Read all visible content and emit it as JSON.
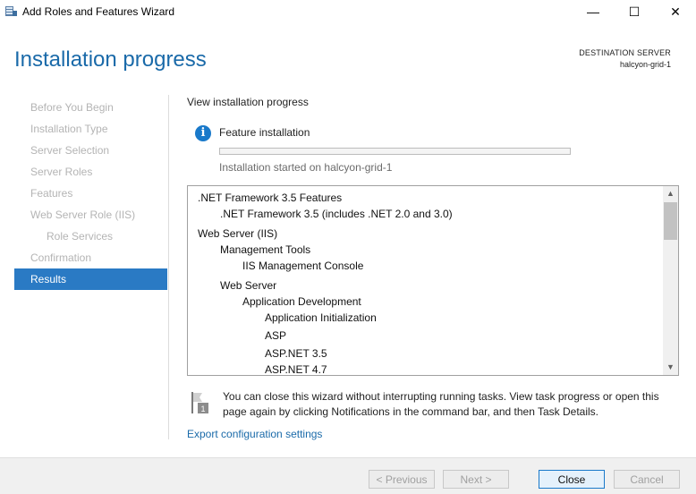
{
  "window": {
    "title": "Add Roles and Features Wizard",
    "minimize_glyph": "—",
    "maximize_glyph": "☐",
    "close_glyph": "✕"
  },
  "header": {
    "page_title": "Installation progress",
    "destination_label": "DESTINATION SERVER",
    "destination_server": "halcyon-grid-1"
  },
  "sidebar": {
    "items": [
      {
        "label": "Before You Begin",
        "state": "disabled"
      },
      {
        "label": "Installation Type",
        "state": "disabled"
      },
      {
        "label": "Server Selection",
        "state": "disabled"
      },
      {
        "label": "Server Roles",
        "state": "disabled"
      },
      {
        "label": "Features",
        "state": "disabled"
      },
      {
        "label": "Web Server Role (IIS)",
        "state": "disabled"
      },
      {
        "label": "Role Services",
        "state": "disabled"
      },
      {
        "label": "Confirmation",
        "state": "disabled"
      },
      {
        "label": "Results",
        "state": "active"
      }
    ]
  },
  "main": {
    "heading": "View installation progress",
    "status_icon": "info-icon",
    "feature_label": "Feature installation",
    "progress_percent": 0,
    "install_status": "Installation started on halcyon-grid-1",
    "tree": [
      {
        "text": ".NET Framework 3.5 Features",
        "level": 0
      },
      {
        "text": ".NET Framework 3.5 (includes .NET 2.0 and 3.0)",
        "level": 1
      },
      {
        "text": "Web Server (IIS)",
        "level": 0
      },
      {
        "text": "Management Tools",
        "level": 1
      },
      {
        "text": "IIS Management Console",
        "level": 2
      },
      {
        "text": "Web Server",
        "level": 1
      },
      {
        "text": "Application Development",
        "level": 2
      },
      {
        "text": "Application Initialization",
        "level": 3
      },
      {
        "text": "ASP",
        "level": 3
      },
      {
        "text": "ASP.NET 3.5",
        "level": 3
      },
      {
        "text": "ASP.NET 4.7",
        "level": 3
      }
    ],
    "note_text": "You can close this wizard without interrupting running tasks. View task progress or open this page again by clicking Notifications in the command bar, and then Task Details.",
    "export_link": "Export configuration settings"
  },
  "footer": {
    "previous_label": "< Previous",
    "next_label": "Next >",
    "close_label": "Close",
    "cancel_label": "Cancel"
  },
  "colors": {
    "accent": "#1a6aa9",
    "active_nav": "#2a7ac4",
    "info": "#1979ca"
  }
}
